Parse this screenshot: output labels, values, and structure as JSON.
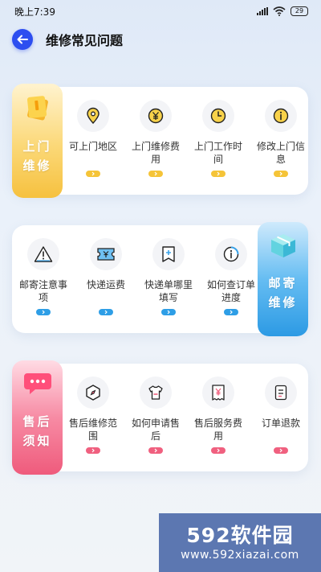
{
  "status_bar": {
    "time": "晚上7:39",
    "battery": "29"
  },
  "header": {
    "title": "维修常见问题"
  },
  "sections": [
    {
      "label_line1": "上门",
      "label_line2": "维修",
      "items": [
        {
          "label": "可上门地区",
          "icon": "location-pin-icon"
        },
        {
          "label": "上门维修费用",
          "icon": "yen-coin-icon"
        },
        {
          "label": "上门工作时间",
          "icon": "clock-icon"
        },
        {
          "label": "修改上门信息",
          "icon": "info-icon"
        }
      ]
    },
    {
      "label_line1": "邮寄",
      "label_line2": "维修",
      "items": [
        {
          "label": "邮寄注意事项",
          "icon": "warning-icon"
        },
        {
          "label": "快递运费",
          "icon": "yen-ticket-icon"
        },
        {
          "label": "快递单哪里填写",
          "icon": "waybill-icon"
        },
        {
          "label": "如何查订单进度",
          "icon": "progress-icon"
        }
      ]
    },
    {
      "label_line1": "售后",
      "label_line2": "须知",
      "items": [
        {
          "label": "售后维修范围",
          "icon": "compass-hexagon-icon"
        },
        {
          "label": "如何申请售后",
          "icon": "shirt-icon"
        },
        {
          "label": "售后服务费用",
          "icon": "yen-receipt-icon"
        },
        {
          "label": "订单退款",
          "icon": "document-icon"
        }
      ]
    }
  ],
  "colors": {
    "door_accent": "#f5c438",
    "mail_accent": "#2e9ee6",
    "aftersale_accent": "#f0607f",
    "back_button": "#2d4ef0"
  },
  "watermark": {
    "brand": "592软件园",
    "url": "www.592xiazai.com"
  }
}
